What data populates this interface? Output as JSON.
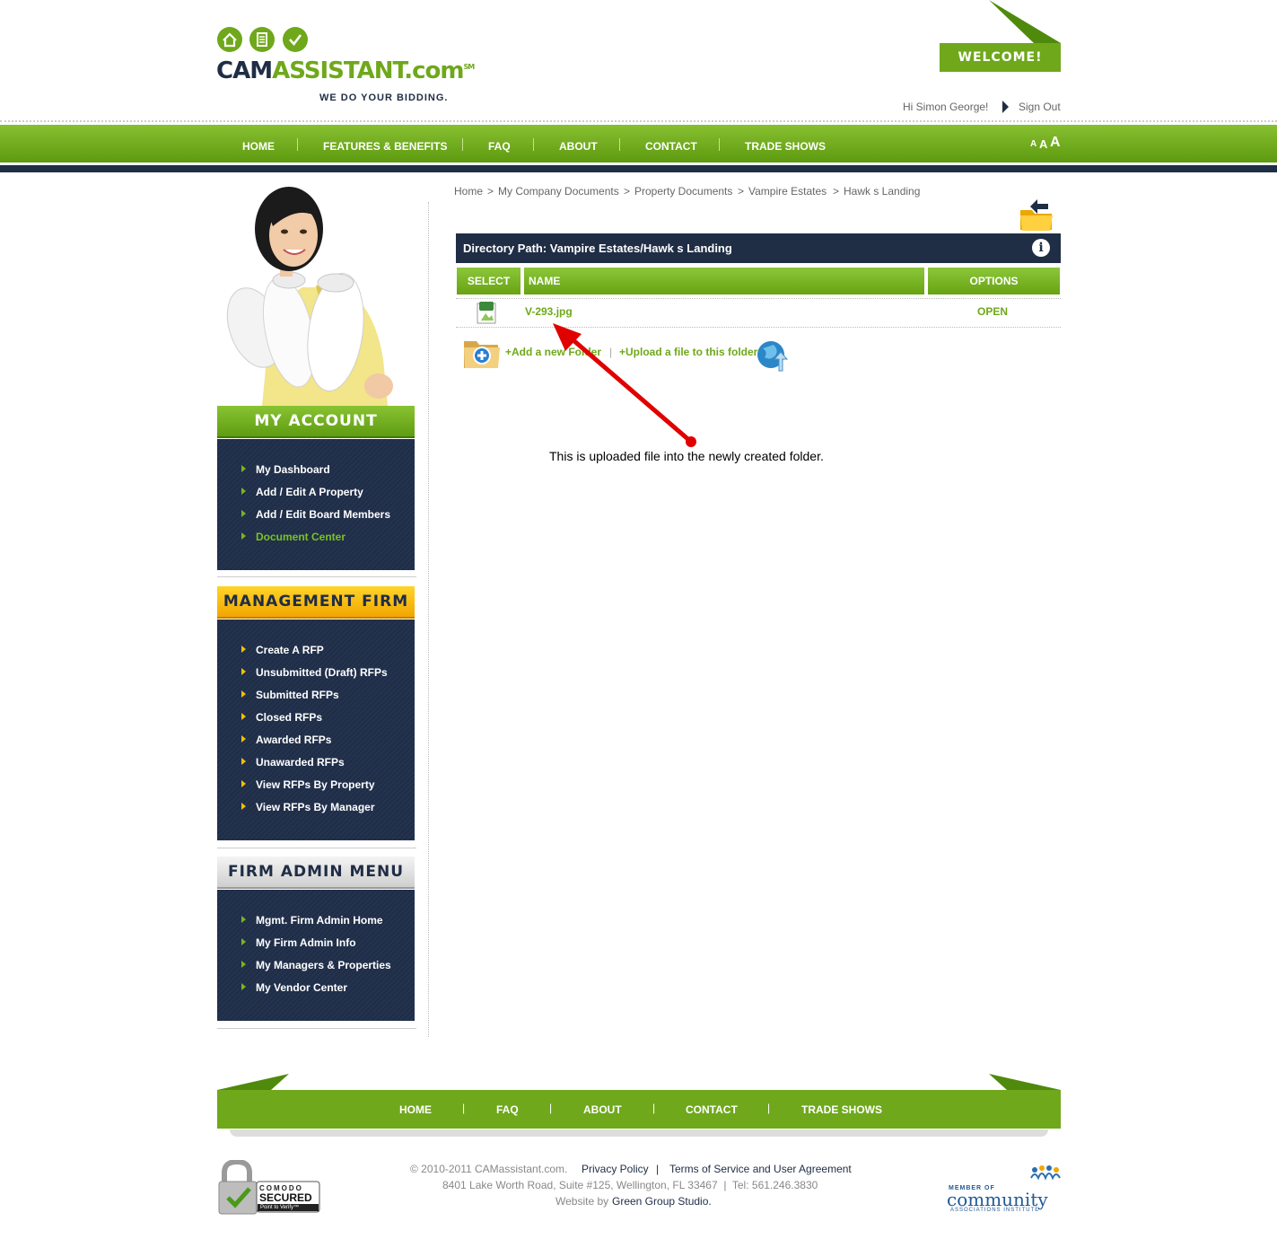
{
  "brand": {
    "name_part1": "CAM",
    "name_part2": "ASSISTANT.com",
    "sm": "SM",
    "tagline": "WE DO YOUR BIDDING.",
    "welcome": "WELCOME!"
  },
  "user_bar": {
    "greeting": "Hi Simon George!",
    "sign_out": "Sign Out"
  },
  "top_nav": [
    "HOME",
    "FEATURES & BENEFITS",
    "FAQ",
    "ABOUT",
    "CONTACT",
    "TRADE SHOWS"
  ],
  "font_sizes": [
    "A",
    "A",
    "A"
  ],
  "sidebar": {
    "my_account": {
      "title": "MY ACCOUNT",
      "items": [
        "My Dashboard",
        "Add / Edit A Property",
        "Add / Edit Board Members",
        "Document Center"
      ]
    },
    "management_firm": {
      "title": "MANAGEMENT FIRM",
      "items": [
        "Create A RFP",
        "Unsubmitted (Draft) RFPs",
        "Submitted RFPs",
        "Closed RFPs",
        "Awarded RFPs",
        "Unawarded RFPs",
        "View RFPs By Property",
        "View RFPs By Manager"
      ]
    },
    "firm_admin": {
      "title": "FIRM ADMIN MENU",
      "items": [
        "Mgmt. Firm Admin Home",
        "My Firm Admin Info",
        "My Managers & Properties",
        "My Vendor Center"
      ]
    }
  },
  "breadcrumb": [
    "Home",
    "My Company Documents",
    "Property Documents",
    "Vampire Estates",
    "Hawk s Landing"
  ],
  "breadcrumb_sep": ">",
  "directory": {
    "path_label": "Directory Path: Vampire Estates/Hawk s Landing",
    "info": "i",
    "columns": [
      "SELECT",
      "NAME",
      "OPTIONS"
    ],
    "files": [
      {
        "name": "V-293.jpg",
        "option": "OPEN"
      }
    ],
    "add_folder": "+Add a new Folder",
    "upload_file": "+Upload a file to this folder",
    "separator": "|"
  },
  "annotation": "This is uploaded file into the newly created folder.",
  "footer": {
    "nav": [
      "HOME",
      "FAQ",
      "ABOUT",
      "CONTACT",
      "TRADE SHOWS"
    ],
    "nav_sep": "|",
    "copyright": "© 2010-2011 CAMassistant.com.",
    "privacy": "Privacy Policy",
    "pipe": "|",
    "terms": "Terms of Service and User Agreement",
    "address": "8401 Lake Worth Road, Suite #125, Wellington, FL 33467  |  Tel: 561.246.3830",
    "website_by": "Website by",
    "studio": "Green Group Studio.",
    "comodo_brand": "COMODO",
    "comodo_secured": "SECURED",
    "comodo_verify": "Point to Verify™",
    "cai_member": "MEMBER OF",
    "cai_community": "community",
    "cai_institute": "ASSOCIATIONS INSTITUTE"
  },
  "colors": {
    "green": "#6fa81b",
    "navy": "#1f2d45",
    "yellow": "#f5b800",
    "red_arrow": "#e00000"
  }
}
